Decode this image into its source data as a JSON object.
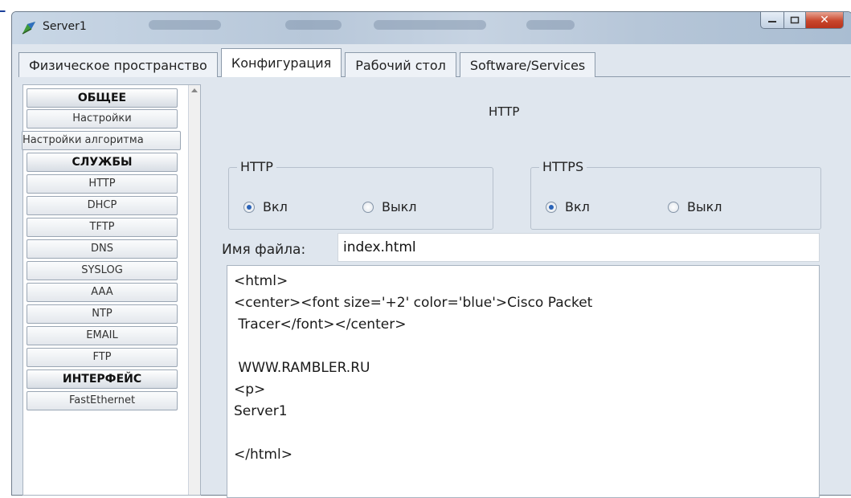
{
  "window": {
    "title": "Server1"
  },
  "tabs": [
    {
      "label": "Физическое пространство",
      "active": false
    },
    {
      "label": "Конфигурация",
      "active": true
    },
    {
      "label": "Рабочий стол",
      "active": false
    },
    {
      "label": "Software/Services",
      "active": false
    }
  ],
  "sidebar": {
    "items": [
      {
        "label": "ОБЩЕЕ",
        "type": "header"
      },
      {
        "label": "Настройки",
        "type": "item"
      },
      {
        "label": "Настройки алгоритма",
        "type": "item"
      },
      {
        "label": "СЛУЖБЫ",
        "type": "header"
      },
      {
        "label": "HTTP",
        "type": "item"
      },
      {
        "label": "DHCP",
        "type": "item"
      },
      {
        "label": "TFTP",
        "type": "item"
      },
      {
        "label": "DNS",
        "type": "item"
      },
      {
        "label": "SYSLOG",
        "type": "item"
      },
      {
        "label": "AAA",
        "type": "item"
      },
      {
        "label": "NTP",
        "type": "item"
      },
      {
        "label": "EMAIL",
        "type": "item"
      },
      {
        "label": "FTP",
        "type": "item"
      },
      {
        "label": "ИНТЕРФЕЙС",
        "type": "header"
      },
      {
        "label": "FastEthernet",
        "type": "item"
      }
    ]
  },
  "main": {
    "section_title": "HTTP",
    "http_group": {
      "legend": "HTTP",
      "on_label": "Вкл",
      "off_label": "Выкл",
      "selected": "on"
    },
    "https_group": {
      "legend": "HTTPS",
      "on_label": "Вкл",
      "off_label": "Выкл",
      "selected": "on"
    },
    "file_name_label": "Имя файла:",
    "file_name_value": "index.html",
    "editor_text": "<html>\n<center><font size='+2' color='blue'>Cisco Packet\n Tracer</font></center>\n\n WWW.RAMBLER.RU\n<p>\nServer1\n\n</html>"
  }
}
